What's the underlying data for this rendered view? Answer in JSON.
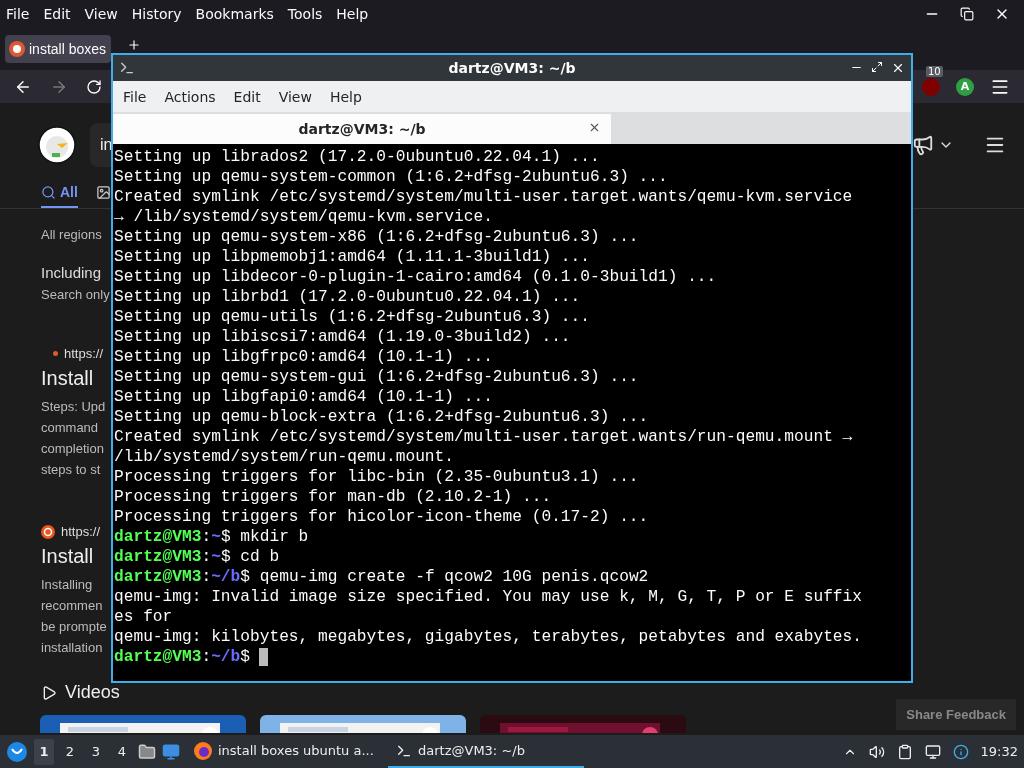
{
  "browser": {
    "menu": [
      "File",
      "Edit",
      "View",
      "History",
      "Bookmarks",
      "Tools",
      "Help"
    ],
    "tab": {
      "title": "install boxes",
      "selected": true
    },
    "toolbar": {
      "badge": "10",
      "avatar": "A"
    },
    "page": {
      "search": {
        "value": "in"
      },
      "tabs": [
        {
          "label": "All",
          "selected": true
        }
      ],
      "region": "All regions",
      "including": "Including",
      "search_only": "Search only",
      "results": [
        {
          "url": "https://",
          "title": "Install",
          "snippet": [
            "Steps: Upd",
            "command",
            "completion",
            "steps to st"
          ]
        },
        {
          "url": "https://",
          "title": "Install",
          "snippet": [
            "Installing",
            "recommen",
            "be prompte",
            "installation"
          ]
        }
      ],
      "videos": {
        "heading": "Videos"
      },
      "feedback": "Share Feedback"
    }
  },
  "terminal": {
    "title": "dartz@VM3: ~/b",
    "menu": [
      "File",
      "Actions",
      "Edit",
      "View",
      "Help"
    ],
    "tab": "dartz@VM3: ~/b",
    "lines": [
      {
        "kind": "text",
        "text": "Setting up librados2 (17.2.0-0ubuntu0.22.04.1) ..."
      },
      {
        "kind": "text",
        "text": "Setting up qemu-system-common (1:6.2+dfsg-2ubuntu6.3) ..."
      },
      {
        "kind": "text",
        "text": "Created symlink /etc/systemd/system/multi-user.target.wants/qemu-kvm.service"
      },
      {
        "kind": "text",
        "text": "→ /lib/systemd/system/qemu-kvm.service."
      },
      {
        "kind": "text",
        "text": "Setting up qemu-system-x86 (1:6.2+dfsg-2ubuntu6.3) ..."
      },
      {
        "kind": "text",
        "text": "Setting up libpmemobj1:amd64 (1.11.1-3build1) ..."
      },
      {
        "kind": "text",
        "text": "Setting up libdecor-0-plugin-1-cairo:amd64 (0.1.0-3build1) ..."
      },
      {
        "kind": "text",
        "text": "Setting up librbd1 (17.2.0-0ubuntu0.22.04.1) ..."
      },
      {
        "kind": "text",
        "text": "Setting up qemu-utils (1:6.2+dfsg-2ubuntu6.3) ..."
      },
      {
        "kind": "text",
        "text": "Setting up libiscsi7:amd64 (1.19.0-3build2) ..."
      },
      {
        "kind": "text",
        "text": "Setting up libgfrpc0:amd64 (10.1-1) ..."
      },
      {
        "kind": "text",
        "text": "Setting up qemu-system-gui (1:6.2+dfsg-2ubuntu6.3) ..."
      },
      {
        "kind": "text",
        "text": "Setting up libgfapi0:amd64 (10.1-1) ..."
      },
      {
        "kind": "text",
        "text": "Setting up qemu-block-extra (1:6.2+dfsg-2ubuntu6.3) ..."
      },
      {
        "kind": "text",
        "text": "Created symlink /etc/systemd/system/multi-user.target.wants/run-qemu.mount →"
      },
      {
        "kind": "text",
        "text": "/lib/systemd/system/run-qemu.mount."
      },
      {
        "kind": "text",
        "text": "Processing triggers for libc-bin (2.35-0ubuntu3.1) ..."
      },
      {
        "kind": "text",
        "text": "Processing triggers for man-db (2.10.2-1) ..."
      },
      {
        "kind": "text",
        "text": "Processing triggers for hicolor-icon-theme (0.17-2) ..."
      },
      {
        "kind": "prompt",
        "user": "dartz@VM3",
        "sep": ":",
        "path": "~",
        "tail": "$ mkdir b",
        "cursor": false
      },
      {
        "kind": "prompt",
        "user": "dartz@VM3",
        "sep": ":",
        "path": "~",
        "tail": "$ cd b",
        "cursor": false
      },
      {
        "kind": "prompt",
        "user": "dartz@VM3",
        "sep": ":",
        "path": "~/b",
        "tail": "$ qemu-img create -f qcow2 10G penis.qcow2",
        "cursor": false
      },
      {
        "kind": "text",
        "text": "qemu-img: Invalid image size specified. You may use k, M, G, T, P or E suffix"
      },
      {
        "kind": "text",
        "text": "es for"
      },
      {
        "kind": "text",
        "text": "qemu-img: kilobytes, megabytes, gigabytes, terabytes, petabytes and exabytes."
      },
      {
        "kind": "prompt",
        "user": "dartz@VM3",
        "sep": ":",
        "path": "~/b",
        "tail": "$",
        "cursor": true
      }
    ]
  },
  "taskbar": {
    "workspaces": [
      {
        "label": "1",
        "selected": true
      },
      {
        "label": "2",
        "selected": false
      },
      {
        "label": "3",
        "selected": false
      },
      {
        "label": "4",
        "selected": false
      }
    ],
    "tasks": [
      {
        "label": "install boxes ubuntu a...",
        "selected": false
      },
      {
        "label": "dartz@VM3: ~/b",
        "selected": true
      }
    ],
    "clock": "19:32"
  }
}
